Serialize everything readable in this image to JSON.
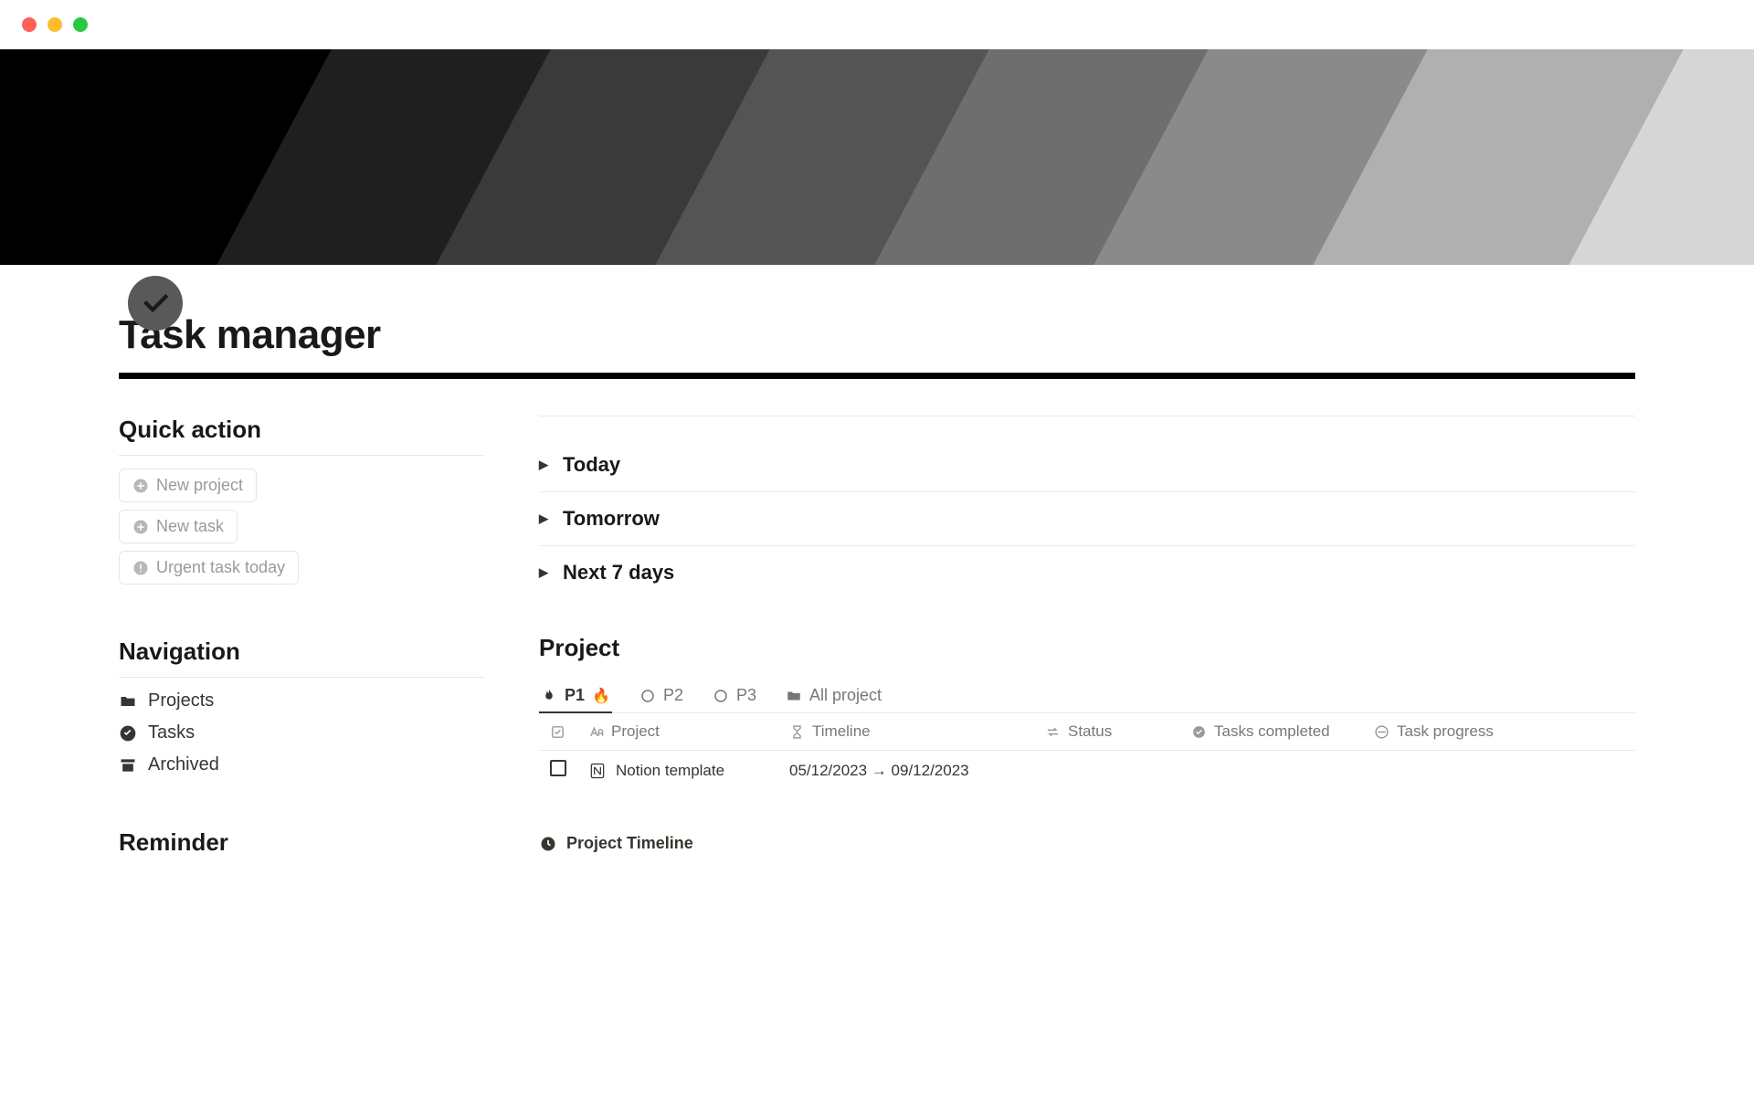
{
  "page": {
    "title": "Task manager"
  },
  "sidebar": {
    "quick_action_heading": "Quick action",
    "navigation_heading": "Navigation",
    "reminder_heading": "Reminder",
    "quick_actions": {
      "new_project": "New project",
      "new_task": "New task",
      "urgent": "Urgent task today"
    },
    "nav": {
      "projects": "Projects",
      "tasks": "Tasks",
      "archived": "Archived"
    }
  },
  "main": {
    "toggles": {
      "today": "Today",
      "tomorrow": "Tomorrow",
      "next7": "Next 7 days"
    },
    "project_heading": "Project",
    "tabs": {
      "p1": "P1",
      "p1_emoji": "🔥",
      "p2": "P2",
      "p3": "P3",
      "all": "All project"
    },
    "columns": {
      "project": "Project",
      "timeline": "Timeline",
      "status": "Status",
      "completed": "Tasks completed",
      "progress": "Task progress"
    },
    "rows": [
      {
        "name": "Notion template",
        "timeline": "05/12/2023 → 09/12/2023"
      }
    ],
    "timeline_link": "Project Timeline"
  }
}
